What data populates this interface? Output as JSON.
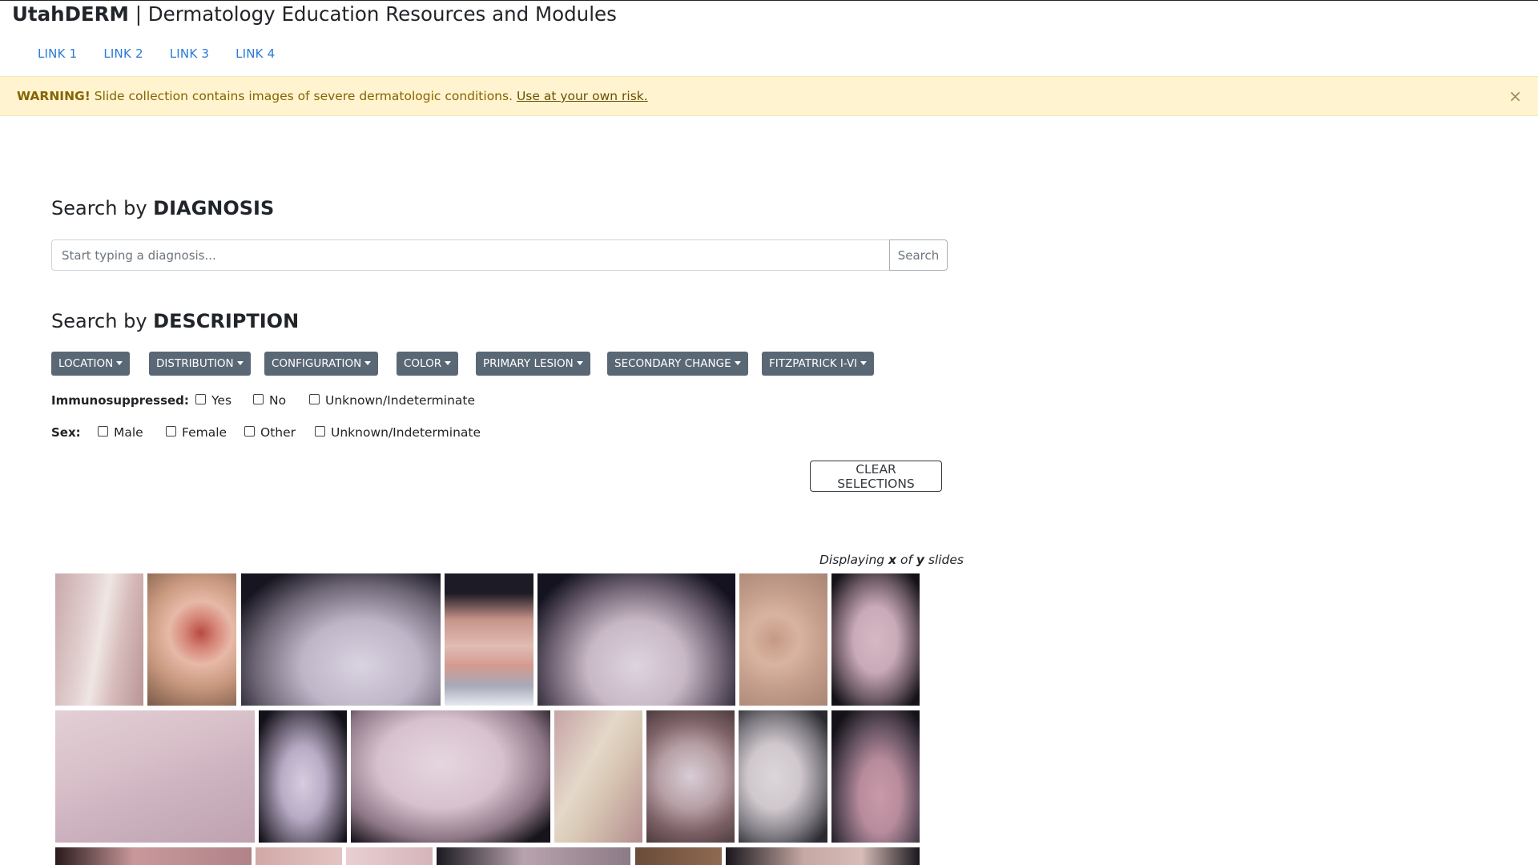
{
  "header": {
    "brand": "UtahDERM",
    "separator": " | ",
    "subtitle": "Dermatology Education Resources and Modules"
  },
  "nav": {
    "links": [
      "LINK 1",
      "LINK 2",
      "LINK 3",
      "LINK 4"
    ]
  },
  "alert": {
    "strong": "WARNING!",
    "text": " Slide collection contains images of severe dermatologic conditions. ",
    "link": "Use at your own risk.",
    "close": "×"
  },
  "diagnosis": {
    "prefix": "Search by ",
    "bold": "DIAGNOSIS",
    "placeholder": "Start typing a diagnosis...",
    "button": "Search"
  },
  "description": {
    "prefix": "Search by ",
    "bold": "DESCRIPTION",
    "filters": [
      "LOCATION",
      "DISTRIBUTION",
      "CONFIGURATION",
      "COLOR",
      "PRIMARY LESION",
      "SECONDARY CHANGE",
      "FITZPATRICK I-VI"
    ]
  },
  "immunosuppressed": {
    "label": "Immunosuppressed:",
    "options": [
      "Yes",
      "No",
      "Unknown/Indeterminate"
    ]
  },
  "sex": {
    "label": "Sex:",
    "options": [
      "Male",
      "Female",
      "Other",
      "Unknown/Indeterminate"
    ]
  },
  "clear_button": "CLEAR SELECTIONS",
  "display": {
    "prefix": "Displaying ",
    "x": "x",
    "middle": " of ",
    "y": "y",
    "suffix": " slides"
  }
}
